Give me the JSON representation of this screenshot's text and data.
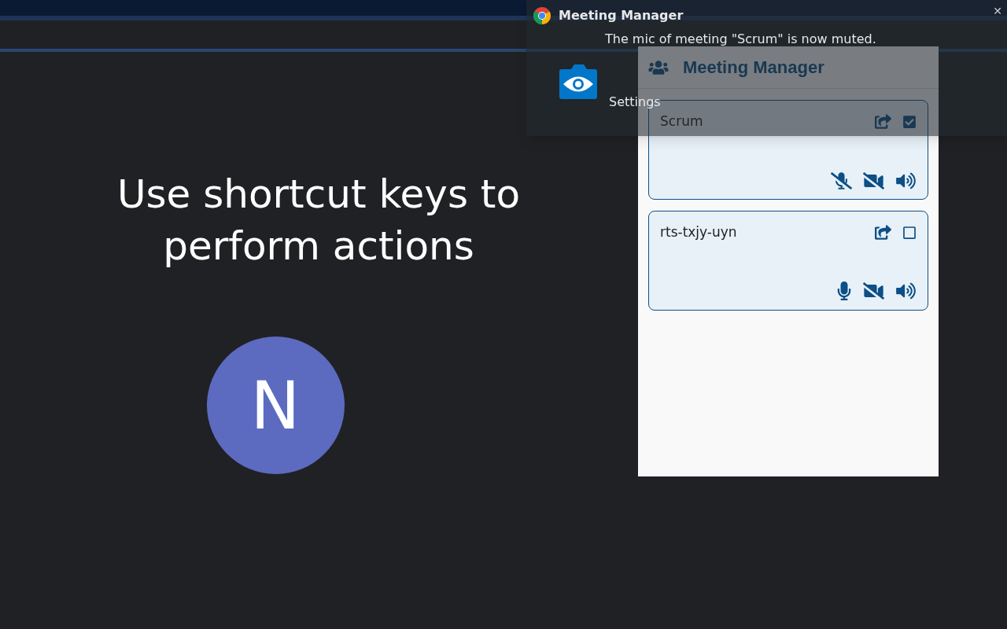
{
  "notification": {
    "app": "Meeting Manager",
    "message": "The mic of meeting \"Scrum\" is now muted.",
    "button": "Settings",
    "close": "✕"
  },
  "page": {
    "heading": "Use shortcut keys to perform actions",
    "avatar_letter": "N"
  },
  "popup": {
    "title": "Meeting Manager",
    "meetings": [
      {
        "name": "Scrum",
        "checked": true,
        "mic_muted": true,
        "camera_off": true
      },
      {
        "name": "rts-txjy-uyn",
        "checked": false,
        "mic_muted": false,
        "camera_off": true
      }
    ]
  }
}
